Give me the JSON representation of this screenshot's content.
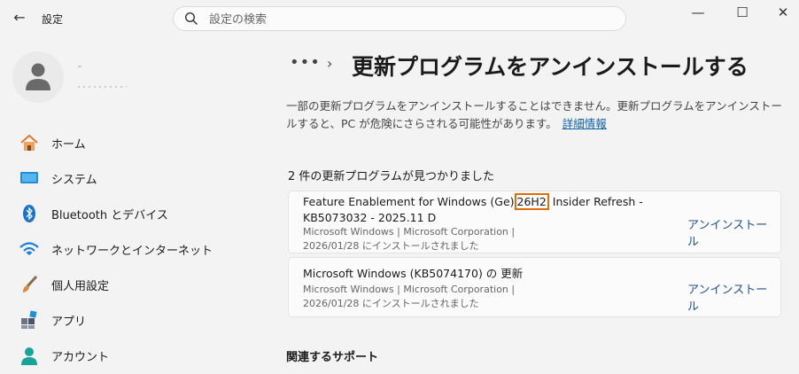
{
  "app": {
    "title": "設定"
  },
  "search": {
    "placeholder": "設定の検索"
  },
  "sidebar": {
    "items": [
      {
        "label": "ホーム"
      },
      {
        "label": "システム"
      },
      {
        "label": "Bluetooth とデバイス"
      },
      {
        "label": "ネットワークとインターネット"
      },
      {
        "label": "個人用設定"
      },
      {
        "label": "アプリ"
      },
      {
        "label": "アカウント"
      }
    ]
  },
  "header": {
    "ellipsis": "•••",
    "chevron": "›",
    "title": "更新プログラムをアンインストールする"
  },
  "description": {
    "text": "一部の更新プログラムをアンインストールすることはできません。更新プログラムをアンインストールすると、PC が危険にさらされる可能性があります。",
    "link": "詳細情報"
  },
  "updates": {
    "count_text": "2 件の更新プログラムが見つかりました",
    "items": [
      {
        "title_before": "Feature Enablement for Windows (Ge)",
        "title_highlight": "26H2",
        "title_after": "Insider Refresh - KB5073032 - 2025.11 D",
        "meta_line1": "Microsoft Windows  |  Microsoft Corporation  |",
        "meta_line2": "2026/01/28 にインストールされました",
        "action": "アンインストール"
      },
      {
        "title": "Microsoft Windows (KB5074170) の 更新",
        "meta_line1": "Microsoft Windows  |  Microsoft Corporation  |",
        "meta_line2": "2026/01/28 にインストールされました",
        "action": "アンインストール"
      }
    ]
  },
  "related": {
    "heading": "関連するサポート"
  },
  "colors": {
    "accent": "#0f5ea8",
    "highlight_border": "#e06c0a",
    "background": "#f3f3f3"
  }
}
